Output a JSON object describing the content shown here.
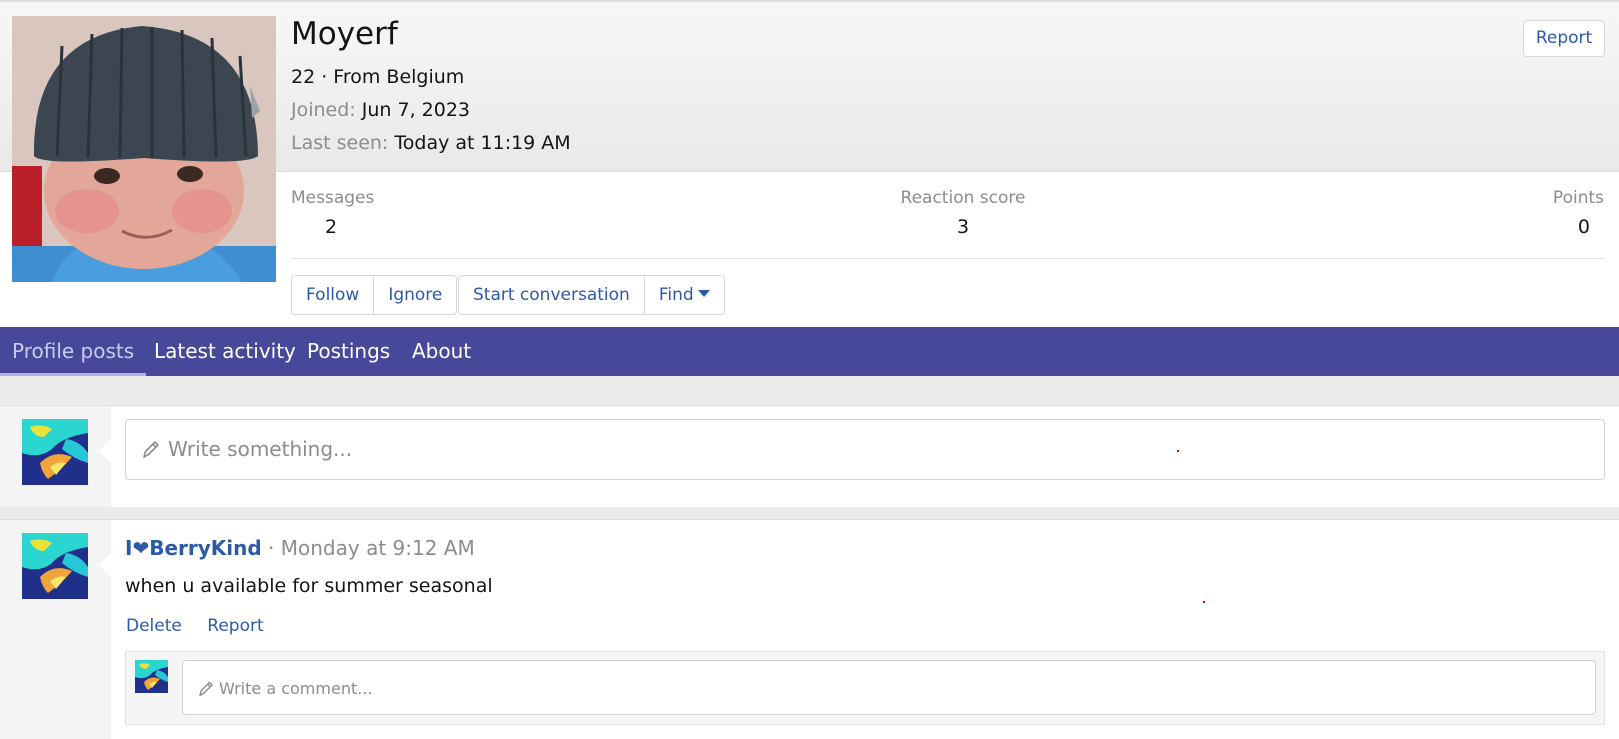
{
  "profile": {
    "username": "Moyerf",
    "age_location": "22 · From Belgium",
    "joined_label": "Joined:",
    "joined_value": "Jun 7, 2023",
    "last_seen_label": "Last seen:",
    "last_seen_value": "Today at 11:19 AM",
    "report_label": "Report"
  },
  "stats": {
    "messages_label": "Messages",
    "messages_value": "2",
    "reaction_label": "Reaction score",
    "reaction_value": "3",
    "points_label": "Points",
    "points_value": "0"
  },
  "actions": {
    "follow": "Follow",
    "ignore": "Ignore",
    "start_conversation": "Start conversation",
    "find": "Find"
  },
  "tabs": [
    {
      "label": "Profile posts",
      "active": true
    },
    {
      "label": "Latest activity",
      "active": false
    },
    {
      "label": "Postings",
      "active": false
    },
    {
      "label": "About",
      "active": false
    }
  ],
  "composer": {
    "placeholder": "Write something..."
  },
  "posts": [
    {
      "author": "I❤BerryKind",
      "separator": "·",
      "time": "Monday at 9:12 AM",
      "body": "when u available for summer seasonal",
      "delete_label": "Delete",
      "report_label": "Report",
      "comment_placeholder": "Write a comment..."
    }
  ],
  "colors": {
    "link": "#2d5aa8",
    "tabbar": "#47489a",
    "muted": "#8c8c8c"
  },
  "icons": {
    "pencil": "pencil-icon",
    "dropdown": "caret-down-icon"
  }
}
